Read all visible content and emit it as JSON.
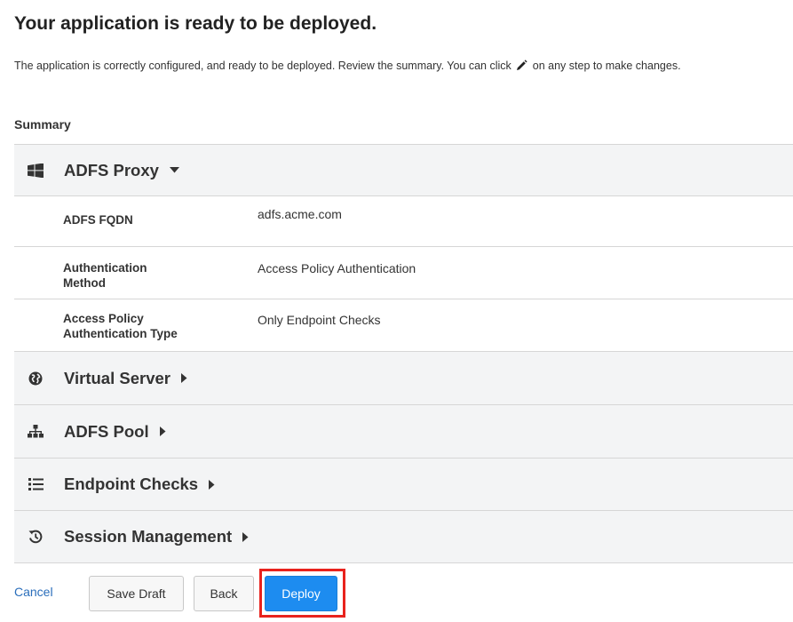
{
  "header": {
    "title": "Your application is ready to be deployed.",
    "intro_before": "The application is correctly configured, and ready to be deployed. Review the summary. You can click",
    "intro_after": "on any step to make changes."
  },
  "summary": {
    "label": "Summary",
    "sections": [
      {
        "title": "ADFS Proxy",
        "icon": "windows-icon",
        "expanded": true,
        "rows": [
          {
            "key": "ADFS FQDN",
            "value": "adfs.acme.com"
          },
          {
            "key": "Authentication Method",
            "value": "Access Policy Authentication"
          },
          {
            "key": "Access Policy Authentication Type",
            "value": "Only Endpoint Checks"
          }
        ]
      },
      {
        "title": "Virtual Server",
        "icon": "globe-icon",
        "expanded": false
      },
      {
        "title": "ADFS Pool",
        "icon": "sitemap-icon",
        "expanded": false
      },
      {
        "title": "Endpoint Checks",
        "icon": "list-icon",
        "expanded": false
      },
      {
        "title": "Session Management",
        "icon": "history-icon",
        "expanded": false
      }
    ]
  },
  "footer": {
    "cancel": "Cancel",
    "save_draft": "Save Draft",
    "back": "Back",
    "deploy": "Deploy"
  },
  "colors": {
    "accent": "#1d8cf0",
    "link": "#2a6ebb",
    "highlight": "#e8221d",
    "section_bg": "#f3f4f5"
  }
}
